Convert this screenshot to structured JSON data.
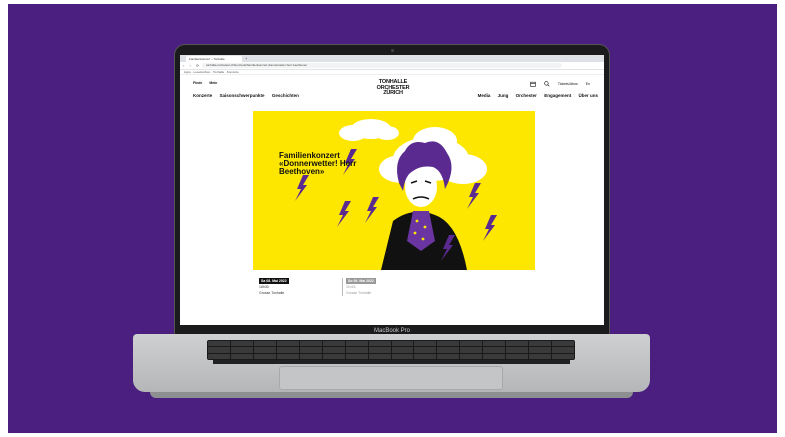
{
  "browser": {
    "tab_title": "Familienkonzert – Tonhalle",
    "new_tab": "+",
    "nav_buttons": "‹ › ⟳",
    "url": "tonhalle-orchester.ch/konzerte/familienkonzert-donnerwetter-herr-beethoven",
    "bookmarks": "Apps  ·  Lesezeichen  ·  Tonhalle  ·  Konzerte"
  },
  "site": {
    "logo_lines": [
      "TONHALLE",
      "ORCHESTER",
      "ZÜRICH"
    ],
    "top_links": [
      "Finde",
      "Mein"
    ],
    "top_right": {
      "calendar_icon": "calendar-icon",
      "search_icon": "search-icon",
      "tickets": "Tickets/Abos",
      "lang": "En"
    },
    "main_nav_left": [
      "Konzerte",
      "Saisonschwerpunkte",
      "Geschichten"
    ],
    "main_nav_right": [
      "Media",
      "Jung",
      "Orchester",
      "Engagement",
      "Über uns"
    ]
  },
  "hero": {
    "title": "Familienkonzert «Donnerwetter! Herr Beethoven»",
    "bg_color": "#fde700",
    "accent_color": "#5b2a91"
  },
  "events": [
    {
      "date": "Sa 08. Mai 2022",
      "time": "16h30",
      "venue": "Grosse Tonhalle"
    },
    {
      "date": "So 09. Mai 2022",
      "time": "11h15",
      "venue": "Grosse Tonhalle"
    }
  ],
  "device": {
    "model_label": "MacBook Pro"
  },
  "colors": {
    "background": "#4b1f80",
    "laptop_frame": "#1b1b1d",
    "laptop_base": "#c4c5c7"
  }
}
